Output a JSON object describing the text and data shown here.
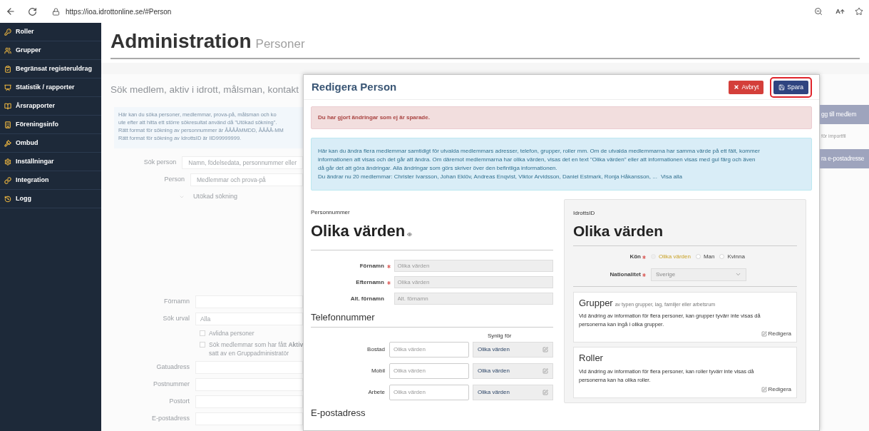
{
  "browser": {
    "url": "https://ioa.idrottonline.se/#Person"
  },
  "sidebar": {
    "items": [
      {
        "label": "Roller"
      },
      {
        "label": "Grupper"
      },
      {
        "label": "Begränsat registeruldrag"
      },
      {
        "label": "Statistik / rapporter"
      },
      {
        "label": "Årsrapporter"
      },
      {
        "label": "Föreningsinfo"
      },
      {
        "label": "Ombud"
      },
      {
        "label": "Inställningar"
      },
      {
        "label": "Integration"
      },
      {
        "label": "Logg"
      }
    ]
  },
  "page": {
    "title": "Administration",
    "subtitle": "Personer"
  },
  "search_panel": {
    "title": "Sök medlem, aktiv i idrott, målsman, kontakt",
    "info_lines": [
      "Här kan du söka personer, medlemmar, prova-på, målsman och ko",
      "ute efter att hitta ett större sökresultat använd då \"Utökad sökning\".",
      "Rätt format för sökning av personnummer är ÅÅÅÅMMDD, ÅÅÅÅ-MM",
      "Rätt format för sökning av IdrottsID är IID99999999."
    ],
    "fields": [
      {
        "label": "Sök person",
        "placeholder": "Namn, födelsedata, personnummer eller"
      },
      {
        "label": "Person",
        "value": "Medlemmar och prova-på"
      }
    ],
    "advanced_toggle": "Utökad sökning",
    "advanced_fields": [
      {
        "label": "Förnamn"
      },
      {
        "label": "Sök urval",
        "value": "Alla"
      }
    ],
    "checkboxes": [
      {
        "lines": [
          "Avlidna personer"
        ],
        "checked": false
      },
      {
        "lines": [
          "Sök medlemmar som har fått **Aktiv**",
          "satt av en Gruppadministratör"
        ],
        "checked": false
      }
    ],
    "address_fields": [
      {
        "label": "Gatuadress"
      },
      {
        "label": "Postnummer"
      },
      {
        "label": "Postort"
      },
      {
        "label": "E-postadress"
      }
    ]
  },
  "right_actions": [
    {
      "kind": "button",
      "label": "gg till medlem"
    },
    {
      "kind": "text",
      "label": "för importfil"
    },
    {
      "kind": "button",
      "label": "ra e-postadresse"
    }
  ],
  "modal": {
    "title": "Redigera Person",
    "buttons": [
      {
        "kind": "cancel",
        "label": "Avbryt",
        "highlighted": false
      },
      {
        "kind": "save",
        "label": "Spara",
        "highlighted": true
      }
    ],
    "warning": "Du har gjort ändringar som ej är sparade.",
    "info": {
      "text": "Här kan du ändra flera medlemmar samtidigt för utvalda medlemmars adresser, telefon, grupper, roller mm. Om de utvalda medlemmarna har samma värde på ett fält, kommer informationen att visas och det går att ändra. Om däremot medlemmarna har olika värden, visas det en text \"Olika värden\" eller att informationen visas med gul färg och även då går det att göra ändringar. Alla ändringar som görs skriver över den befintliga informationen.",
      "members_line": "Du ändrar nu 20 medlemmar: Christer Ivarsson, Johan Eklöv, Andreas Enqvist, Viktor Arvidsson, Daniel Estmark, Ronja Håkansson, ...",
      "link": "Visa alla"
    },
    "personnummer": {
      "label": "Personnummer",
      "value": "Olika värden"
    },
    "name_fields": [
      {
        "label": "Förnamn",
        "required": true,
        "placeholder": "Olika värden"
      },
      {
        "label": "Efternamn",
        "required": true,
        "placeholder": "Olika värden"
      },
      {
        "label": "Alt. förnamn",
        "required": false,
        "placeholder": "Alt. förnamn"
      }
    ],
    "phone": {
      "title": "Telefonnummer",
      "visibility_header": "Synlig för",
      "rows": [
        {
          "label": "Bostad",
          "placeholder": "Olika värden",
          "visibility": "Olika värden"
        },
        {
          "label": "Mobil",
          "placeholder": "Olika värden",
          "visibility": "Olika värden"
        },
        {
          "label": "Arbete",
          "placeholder": "Olika värden",
          "visibility": "Olika värden"
        }
      ]
    },
    "email_title": "E-postadress",
    "idrotts_id": {
      "label": "IdrottsID",
      "value": "Olika värden"
    },
    "gender": {
      "label": "Kön",
      "required": true,
      "options": [
        {
          "label": "Olika värden",
          "selected": true
        },
        {
          "label": "Man",
          "selected": false
        },
        {
          "label": "Kvinna",
          "selected": false
        }
      ]
    },
    "nationality": {
      "label": "Nationalitet",
      "required": true,
      "value": "Sverige"
    },
    "cards": [
      {
        "title": "Grupper",
        "subtitle": "av typen grupper, lag, familjer eller arbetsrum",
        "text": "Vid ändring av information för flera personer, kan grupper tyvärr inte visas då personerna kan ingå i olika grupper.",
        "action": "Redigera"
      },
      {
        "title": "Roller",
        "text": "Vid ändring av information för flera personer, kan roller tyvärr inte visas då personerna kan ha olika roller.",
        "action": "Redigera"
      }
    ]
  }
}
